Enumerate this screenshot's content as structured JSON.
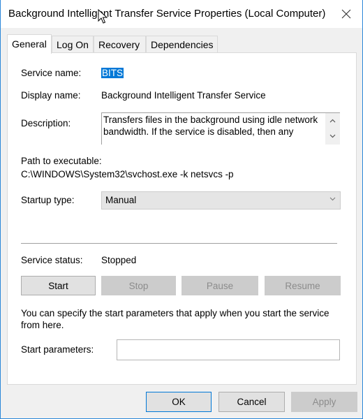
{
  "window": {
    "title": "Background Intelligent Transfer Service Properties (Local Computer)",
    "close_icon": "close-icon",
    "accent_color": "#0078d7"
  },
  "tabs": [
    {
      "label": "General",
      "active": true
    },
    {
      "label": "Log On",
      "active": false
    },
    {
      "label": "Recovery",
      "active": false
    },
    {
      "label": "Dependencies",
      "active": false
    }
  ],
  "general": {
    "service_name_label": "Service name:",
    "service_name_value": "BITS",
    "display_name_label": "Display name:",
    "display_name_value": "Background Intelligent Transfer Service",
    "description_label": "Description:",
    "description_value": "Transfers files in the background using idle network bandwidth. If the service is disabled, then any",
    "path_label": "Path to executable:",
    "path_value": "C:\\WINDOWS\\System32\\svchost.exe -k netsvcs -p",
    "startup_type_label": "Startup type:",
    "startup_type_value": "Manual",
    "service_status_label": "Service status:",
    "service_status_value": "Stopped",
    "control_buttons": {
      "start": "Start",
      "stop": "Stop",
      "pause": "Pause",
      "resume": "Resume"
    },
    "info_text": "You can specify the start parameters that apply when you start the service from here.",
    "start_params_label": "Start parameters:",
    "start_params_value": ""
  },
  "footer": {
    "ok": "OK",
    "cancel": "Cancel",
    "apply": "Apply"
  }
}
